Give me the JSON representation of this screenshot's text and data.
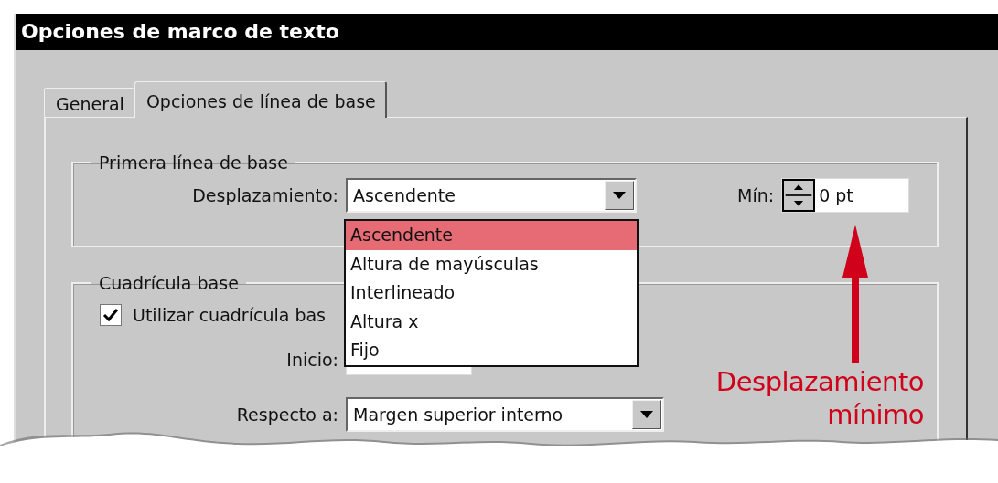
{
  "window": {
    "title": "Opciones de marco de texto"
  },
  "tabs": [
    {
      "label": "General",
      "selected": false
    },
    {
      "label": "Opciones de línea de base",
      "selected": true
    }
  ],
  "first_baseline": {
    "title": "Primera línea de base",
    "offset": {
      "label": "Desplazamiento:",
      "value": "Ascendente"
    },
    "min": {
      "label": "Mín:",
      "value": "0 pt"
    }
  },
  "dropdown": {
    "options": [
      {
        "label": "Ascendente",
        "selected": true
      },
      {
        "label": "Altura de mayúsculas",
        "selected": false
      },
      {
        "label": "Interlineado",
        "selected": false
      },
      {
        "label": "Altura x",
        "selected": false
      },
      {
        "label": "Fijo",
        "selected": false
      }
    ]
  },
  "baseline_grid": {
    "title": "Cuadrícula base",
    "use_grid": {
      "label": "Utilizar cuadrícula bas",
      "checked": true
    },
    "start": {
      "label": "Inicio:"
    },
    "relative_to": {
      "label": "Respecto a:",
      "value": "Margen superior interno"
    }
  },
  "annotation": {
    "text": "Desplazamiento mínimo"
  }
}
